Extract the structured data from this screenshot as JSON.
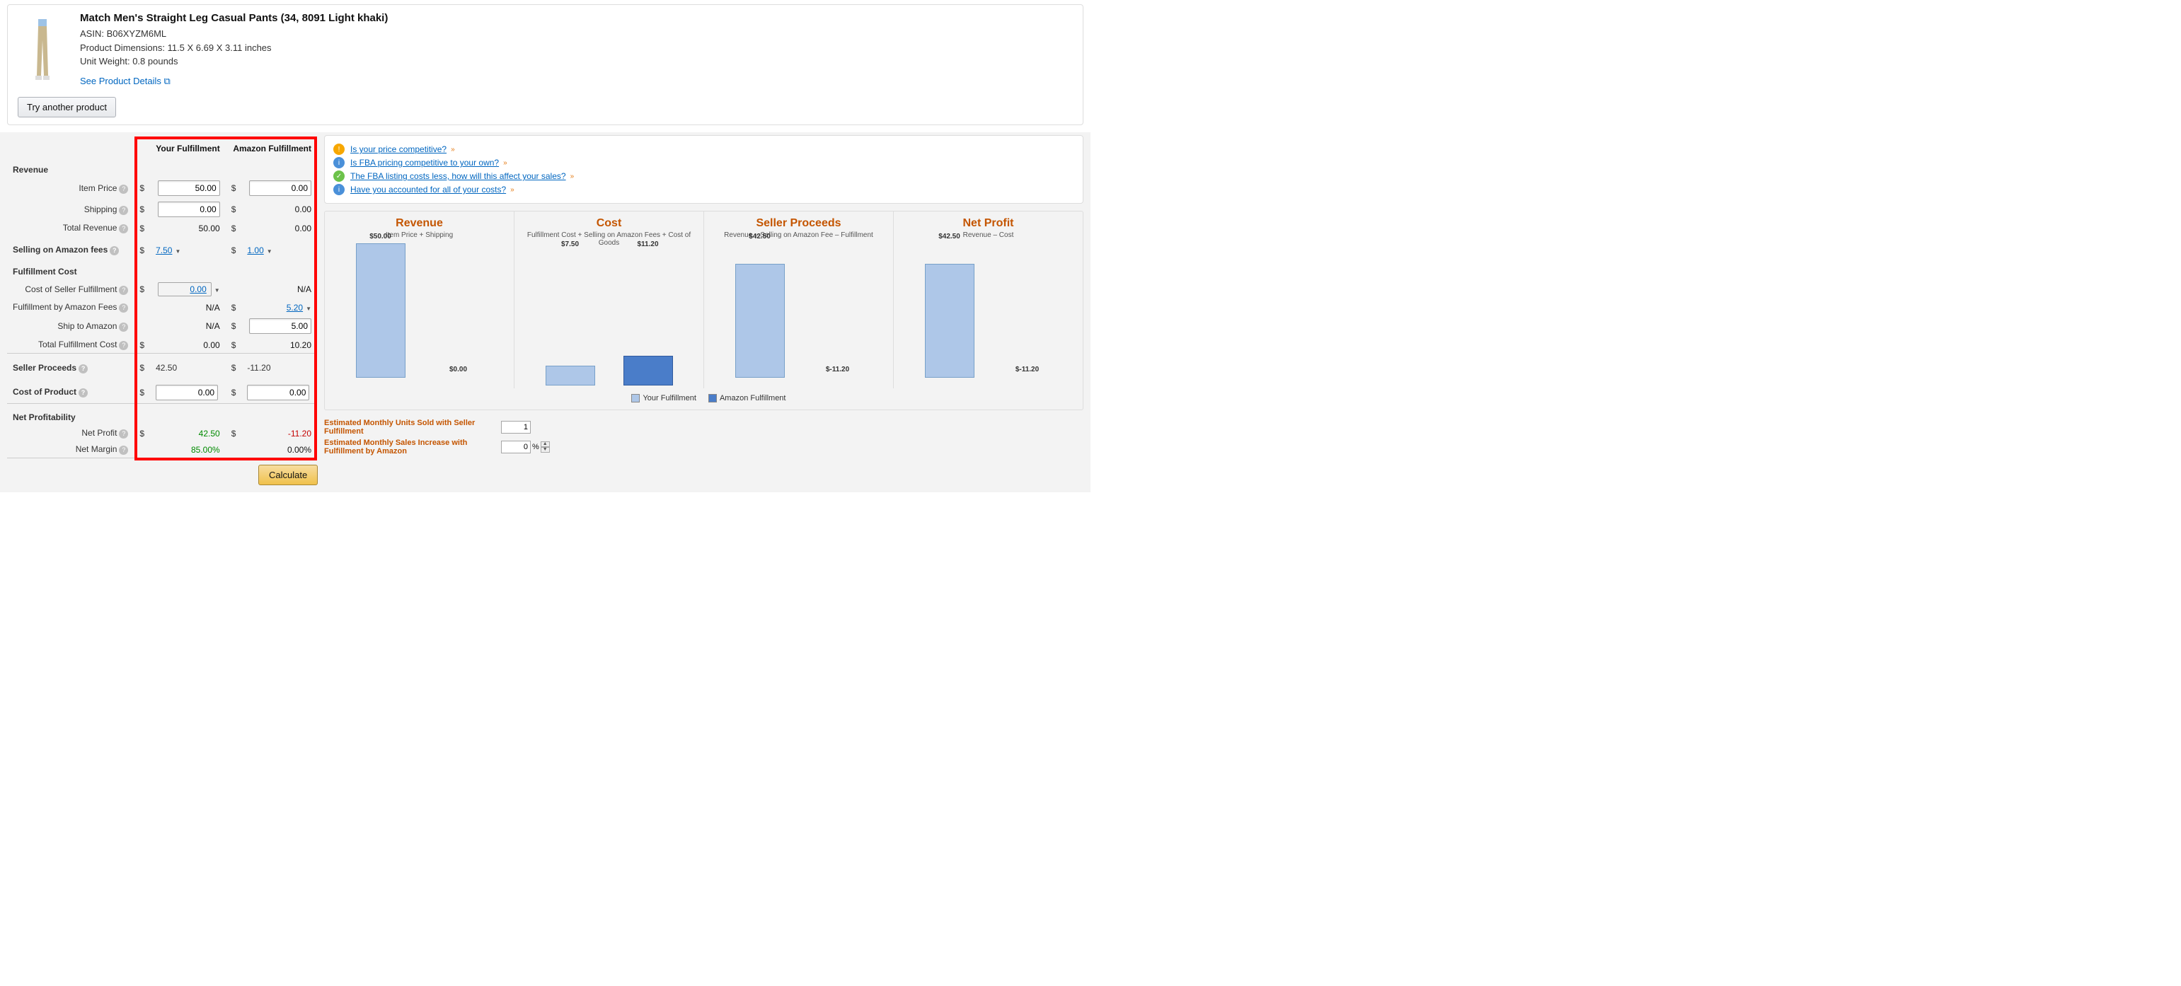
{
  "product": {
    "title": "Match Men's Straight Leg Casual Pants (34, 8091 Light khaki)",
    "asin_label": "ASIN:",
    "asin": "B06XYZM6ML",
    "dimensions_label": "Product Dimensions:",
    "dimensions": "11.5 X 6.69 X 3.11 inches",
    "weight_label": "Unit Weight:",
    "weight": "0.8 pounds",
    "details_link": "See Product Details",
    "try_another": "Try another product"
  },
  "columns": {
    "your": "Your Fulfillment",
    "amazon": "Amazon Fulfillment"
  },
  "sections": {
    "revenue": "Revenue",
    "selling_fees": "Selling on Amazon fees",
    "fulfillment_cost": "Fulfillment Cost",
    "seller_proceeds": "Seller Proceeds",
    "cost_of_product": "Cost of Product",
    "net_profitability": "Net Profitability"
  },
  "rows": {
    "item_price": {
      "label": "Item Price",
      "your": "50.00",
      "amazon": "0.00"
    },
    "shipping": {
      "label": "Shipping",
      "your": "0.00",
      "amazon": "0.00"
    },
    "total_revenue": {
      "label": "Total Revenue",
      "your": "50.00",
      "amazon": "0.00"
    },
    "selling_fees": {
      "your": "7.50",
      "amazon": "1.00"
    },
    "cost_seller_fulfillment": {
      "label": "Cost of Seller Fulfillment",
      "your": "0.00",
      "amazon": "N/A"
    },
    "fba_fees": {
      "label": "Fulfillment by Amazon Fees",
      "your": "N/A",
      "amazon": "5.20"
    },
    "ship_to_amazon": {
      "label": "Ship to Amazon",
      "your": "N/A",
      "amazon": "5.00"
    },
    "total_fulfillment": {
      "label": "Total Fulfillment Cost",
      "your": "0.00",
      "amazon": "10.20"
    },
    "seller_proceeds": {
      "your": "42.50",
      "amazon": "-11.20"
    },
    "cost_of_product": {
      "your": "0.00",
      "amazon": "0.00"
    },
    "net_profit": {
      "label": "Net Profit",
      "your": "42.50",
      "amazon": "-11.20"
    },
    "net_margin": {
      "label": "Net Margin",
      "your": "85.00%",
      "amazon": "0.00%"
    }
  },
  "na": "N/A",
  "calculate": "Calculate",
  "alerts": [
    {
      "icon": "warn",
      "text": "Is your price competitive?",
      "caret": "»"
    },
    {
      "icon": "info",
      "text": "Is FBA pricing competitive to your own?",
      "caret": "»"
    },
    {
      "icon": "check",
      "text": "The FBA listing costs less, how will this affect your sales?",
      "caret": "»"
    },
    {
      "icon": "info",
      "text": "Have you accounted for all of your costs?",
      "caret": "»"
    }
  ],
  "charts": {
    "revenue": {
      "title": "Revenue",
      "sub": "Item Price + Shipping"
    },
    "cost": {
      "title": "Cost",
      "sub": "Fulfillment Cost + Selling on Amazon Fees + Cost of Goods"
    },
    "proceeds": {
      "title": "Seller Proceeds",
      "sub": "Revenue – Selling on Amazon Fee – Fulfillment"
    },
    "netprofit": {
      "title": "Net Profit",
      "sub": "Revenue – Cost"
    }
  },
  "chart_data": [
    {
      "type": "bar",
      "title": "Revenue",
      "categories": [
        "Your Fulfillment",
        "Amazon Fulfillment"
      ],
      "values": [
        50.0,
        0.0
      ],
      "labels": [
        "$50.00",
        "$0.00"
      ],
      "ylim": [
        0,
        50
      ]
    },
    {
      "type": "bar",
      "title": "Cost",
      "categories": [
        "Your Fulfillment",
        "Amazon Fulfillment"
      ],
      "values": [
        7.5,
        11.2
      ],
      "labels": [
        "$7.50",
        "$11.20"
      ],
      "ylim": [
        0,
        50
      ]
    },
    {
      "type": "bar",
      "title": "Seller Proceeds",
      "categories": [
        "Your Fulfillment",
        "Amazon Fulfillment"
      ],
      "values": [
        42.5,
        -11.2
      ],
      "labels": [
        "$42.50",
        "$-11.20"
      ],
      "ylim": [
        0,
        50
      ]
    },
    {
      "type": "bar",
      "title": "Net Profit",
      "categories": [
        "Your Fulfillment",
        "Amazon Fulfillment"
      ],
      "values": [
        42.5,
        -11.2
      ],
      "labels": [
        "$42.50",
        "$-11.20"
      ],
      "ylim": [
        0,
        50
      ]
    }
  ],
  "legend": {
    "your": "Your Fulfillment",
    "amazon": "Amazon Fulfillment"
  },
  "estimates": {
    "units_label": "Estimated Monthly Units Sold with Seller Fulfillment",
    "units_value": "1",
    "increase_label": "Estimated Monthly Sales Increase with Fulfillment by Amazon",
    "increase_value": "0",
    "increase_suffix": "%"
  }
}
